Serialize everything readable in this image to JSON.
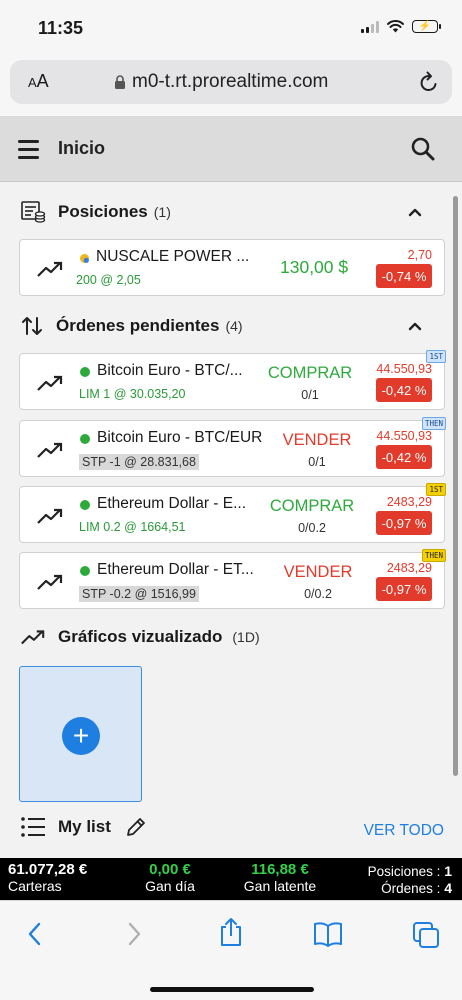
{
  "status": {
    "time": "11:35"
  },
  "browser": {
    "aa_big": "A",
    "aa_small": "A",
    "url": "m0-t.rt.prorealtime.com"
  },
  "header": {
    "title": "Inicio"
  },
  "positions": {
    "title": "Posiciones",
    "count": "(1)",
    "items": [
      {
        "icon": "stock-dot-icon",
        "name": "NUSCALE POWER ...",
        "sub": "200 @ 2,05",
        "value": "130,00 $",
        "price": "2,70",
        "pct": "-0,74 %"
      }
    ]
  },
  "orders": {
    "title": "Órdenes pendientes",
    "count": "(4)",
    "items": [
      {
        "name": "Bitcoin Euro - BTC/...",
        "sub": "LIM 1 @ 30.035,20",
        "action": "COMPRAR",
        "qty": "0/1",
        "price": "44.550,93",
        "pct": "-0,42 %",
        "tag": "1ST"
      },
      {
        "name": "Bitcoin Euro - BTC/EUR",
        "sub": "STP -1 @ 28.831,68",
        "action": "VENDER",
        "qty": "0/1",
        "price": "44.550,93",
        "pct": "-0,42 %",
        "tag": "THEN"
      },
      {
        "name": "Ethereum Dollar - E...",
        "sub": "LIM 0.2 @ 1664,51",
        "action": "COMPRAR",
        "qty": "0/0.2",
        "price": "2483,29",
        "pct": "-0,97 %",
        "tag": "1ST"
      },
      {
        "name": "Ethereum Dollar - ET...",
        "sub": "STP -0.2 @ 1516,99",
        "action": "VENDER",
        "qty": "0/0.2",
        "price": "2483,29",
        "pct": "-0,97 %",
        "tag": "THEN"
      }
    ]
  },
  "charts": {
    "title": "Gráficos vizualizado",
    "period": "(1D)",
    "add_label": "+"
  },
  "mylist": {
    "title": "My list",
    "ver_todo": "VER TODO"
  },
  "summary": {
    "carteras_value": "61.077,28 €",
    "carteras_label": "Carteras",
    "gan_dia_value": "0,00 €",
    "gan_dia_label": "Gan día",
    "gan_latente_value": "116,88 €",
    "gan_latente_label": "Gan latente",
    "posiciones_label": "Posiciones :",
    "posiciones_value": "1",
    "ordenes_label": "Órdenes :",
    "ordenes_value": "4"
  },
  "colors": {
    "green": "#2eaa3c",
    "red": "#e23a2b",
    "blue": "#1f7fe0",
    "tag_blue": "#cfe4fb",
    "tag_yellow": "#f5d000"
  }
}
